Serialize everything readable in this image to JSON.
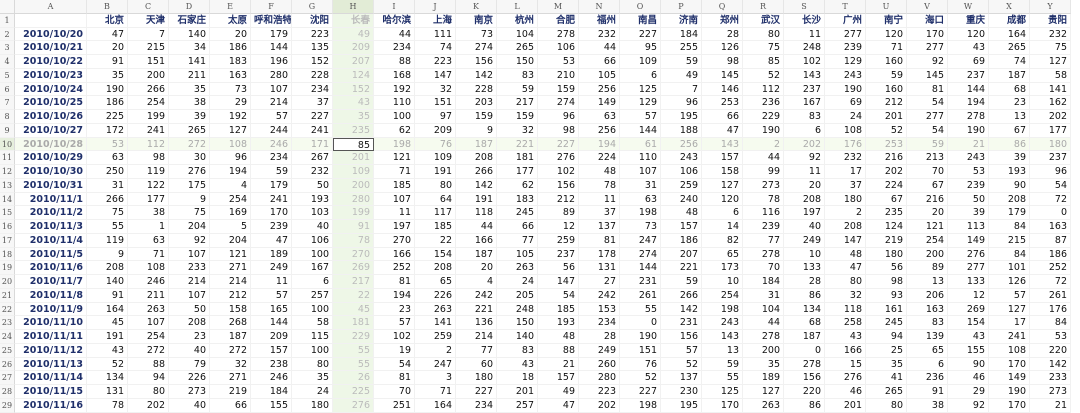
{
  "sheet": {
    "column_letters": [
      "A",
      "B",
      "C",
      "D",
      "E",
      "F",
      "G",
      "H",
      "I",
      "J",
      "K",
      "L",
      "M",
      "N",
      "O",
      "P",
      "Q",
      "R",
      "S",
      "T",
      "U",
      "V",
      "W",
      "X",
      "Y"
    ],
    "cities": [
      "北京",
      "天津",
      "石家庄",
      "太原",
      "呼和浩特",
      "沈阳",
      "长春",
      "哈尔滨",
      "上海",
      "南京",
      "杭州",
      "合肥",
      "福州",
      "南昌",
      "济南",
      "郑州",
      "武汉",
      "长沙",
      "广州",
      "南宁",
      "海口",
      "重庆",
      "成都",
      "贵阳"
    ],
    "selected_column": "H",
    "selected_row": 10,
    "active_cell_value": "85",
    "rows": [
      {
        "num": "2",
        "date": "2010/10/20",
        "values": [
          "47",
          "7",
          "140",
          "20",
          "179",
          "223",
          "49",
          "44",
          "111",
          "73",
          "104",
          "278",
          "232",
          "227",
          "184",
          "28",
          "80",
          "11",
          "277",
          "120",
          "170",
          "120",
          "164",
          "232"
        ]
      },
      {
        "num": "3",
        "date": "2010/10/21",
        "values": [
          "20",
          "215",
          "34",
          "186",
          "144",
          "135",
          "209",
          "234",
          "74",
          "274",
          "265",
          "106",
          "44",
          "95",
          "255",
          "126",
          "75",
          "248",
          "239",
          "71",
          "277",
          "43",
          "265",
          "75"
        ]
      },
      {
        "num": "4",
        "date": "2010/10/22",
        "values": [
          "91",
          "151",
          "141",
          "183",
          "196",
          "152",
          "207",
          "88",
          "223",
          "156",
          "150",
          "53",
          "66",
          "109",
          "59",
          "98",
          "85",
          "102",
          "129",
          "160",
          "92",
          "69",
          "74",
          "127"
        ]
      },
      {
        "num": "5",
        "date": "2010/10/23",
        "values": [
          "35",
          "200",
          "211",
          "163",
          "280",
          "228",
          "124",
          "168",
          "147",
          "142",
          "83",
          "210",
          "105",
          "6",
          "49",
          "145",
          "52",
          "143",
          "243",
          "59",
          "145",
          "237",
          "187",
          "58"
        ]
      },
      {
        "num": "6",
        "date": "2010/10/24",
        "values": [
          "190",
          "266",
          "35",
          "73",
          "107",
          "234",
          "152",
          "192",
          "32",
          "228",
          "59",
          "159",
          "256",
          "125",
          "7",
          "146",
          "112",
          "237",
          "190",
          "160",
          "81",
          "144",
          "68",
          "141"
        ]
      },
      {
        "num": "7",
        "date": "2010/10/25",
        "values": [
          "186",
          "254",
          "38",
          "29",
          "214",
          "37",
          "43",
          "110",
          "151",
          "203",
          "217",
          "274",
          "149",
          "129",
          "96",
          "253",
          "236",
          "167",
          "69",
          "212",
          "54",
          "194",
          "23",
          "162"
        ]
      },
      {
        "num": "8",
        "date": "2010/10/26",
        "values": [
          "225",
          "199",
          "39",
          "192",
          "57",
          "227",
          "35",
          "100",
          "97",
          "159",
          "159",
          "96",
          "63",
          "57",
          "195",
          "66",
          "229",
          "83",
          "24",
          "201",
          "277",
          "278",
          "13",
          "202"
        ]
      },
      {
        "num": "9",
        "date": "2010/10/27",
        "values": [
          "172",
          "241",
          "265",
          "127",
          "244",
          "241",
          "235",
          "62",
          "209",
          "9",
          "32",
          "98",
          "256",
          "144",
          "188",
          "47",
          "190",
          "6",
          "108",
          "52",
          "54",
          "190",
          "67",
          "177"
        ]
      },
      {
        "num": "10",
        "date": "2010/10/28",
        "values": [
          "53",
          "112",
          "272",
          "108",
          "246",
          "171",
          "85",
          "198",
          "76",
          "187",
          "221",
          "227",
          "194",
          "61",
          "256",
          "143",
          "2",
          "202",
          "176",
          "253",
          "59",
          "21",
          "86",
          "180"
        ]
      },
      {
        "num": "11",
        "date": "2010/10/29",
        "values": [
          "63",
          "98",
          "30",
          "96",
          "234",
          "267",
          "201",
          "121",
          "109",
          "208",
          "181",
          "276",
          "224",
          "110",
          "243",
          "157",
          "44",
          "92",
          "232",
          "216",
          "213",
          "243",
          "39",
          "237"
        ]
      },
      {
        "num": "12",
        "date": "2010/10/30",
        "values": [
          "250",
          "119",
          "276",
          "194",
          "59",
          "232",
          "109",
          "71",
          "191",
          "266",
          "177",
          "102",
          "48",
          "107",
          "106",
          "158",
          "99",
          "11",
          "17",
          "202",
          "70",
          "53",
          "193",
          "96"
        ]
      },
      {
        "num": "13",
        "date": "2010/10/31",
        "values": [
          "31",
          "122",
          "175",
          "4",
          "179",
          "50",
          "200",
          "185",
          "80",
          "142",
          "62",
          "156",
          "78",
          "31",
          "259",
          "127",
          "273",
          "20",
          "37",
          "224",
          "67",
          "239",
          "90",
          "54"
        ]
      },
      {
        "num": "14",
        "date": "2010/11/1",
        "values": [
          "266",
          "177",
          "9",
          "254",
          "241",
          "193",
          "280",
          "107",
          "64",
          "191",
          "183",
          "212",
          "11",
          "63",
          "240",
          "120",
          "78",
          "208",
          "180",
          "67",
          "216",
          "50",
          "208",
          "72"
        ]
      },
      {
        "num": "15",
        "date": "2010/11/2",
        "values": [
          "75",
          "38",
          "75",
          "169",
          "170",
          "103",
          "199",
          "11",
          "117",
          "118",
          "245",
          "89",
          "37",
          "198",
          "48",
          "6",
          "116",
          "197",
          "2",
          "235",
          "20",
          "39",
          "179",
          "0"
        ]
      },
      {
        "num": "16",
        "date": "2010/11/3",
        "values": [
          "55",
          "1",
          "204",
          "5",
          "239",
          "40",
          "91",
          "197",
          "185",
          "44",
          "66",
          "12",
          "137",
          "73",
          "157",
          "14",
          "239",
          "40",
          "208",
          "124",
          "121",
          "113",
          "84",
          "163"
        ]
      },
      {
        "num": "17",
        "date": "2010/11/4",
        "values": [
          "119",
          "63",
          "92",
          "204",
          "47",
          "106",
          "78",
          "270",
          "22",
          "166",
          "77",
          "259",
          "81",
          "247",
          "186",
          "82",
          "77",
          "249",
          "147",
          "219",
          "254",
          "149",
          "215",
          "87"
        ]
      },
      {
        "num": "18",
        "date": "2010/11/5",
        "values": [
          "9",
          "71",
          "107",
          "121",
          "189",
          "100",
          "270",
          "166",
          "154",
          "187",
          "105",
          "237",
          "178",
          "274",
          "207",
          "65",
          "278",
          "10",
          "48",
          "180",
          "200",
          "276",
          "84",
          "186"
        ]
      },
      {
        "num": "19",
        "date": "2010/11/6",
        "values": [
          "208",
          "108",
          "233",
          "271",
          "249",
          "167",
          "269",
          "252",
          "208",
          "20",
          "263",
          "56",
          "131",
          "144",
          "221",
          "173",
          "70",
          "133",
          "47",
          "56",
          "89",
          "277",
          "101",
          "252"
        ]
      },
      {
        "num": "20",
        "date": "2010/11/7",
        "values": [
          "140",
          "246",
          "214",
          "214",
          "11",
          "6",
          "217",
          "81",
          "65",
          "4",
          "24",
          "147",
          "27",
          "231",
          "59",
          "10",
          "184",
          "28",
          "80",
          "98",
          "13",
          "133",
          "126",
          "72"
        ]
      },
      {
        "num": "21",
        "date": "2010/11/8",
        "values": [
          "91",
          "211",
          "107",
          "212",
          "57",
          "257",
          "22",
          "194",
          "226",
          "242",
          "205",
          "54",
          "242",
          "261",
          "266",
          "254",
          "31",
          "86",
          "32",
          "93",
          "206",
          "12",
          "57",
          "261"
        ]
      },
      {
        "num": "22",
        "date": "2010/11/9",
        "values": [
          "164",
          "263",
          "50",
          "158",
          "165",
          "100",
          "45",
          "23",
          "263",
          "221",
          "248",
          "185",
          "153",
          "55",
          "142",
          "198",
          "104",
          "134",
          "118",
          "161",
          "163",
          "269",
          "127",
          "176"
        ]
      },
      {
        "num": "23",
        "date": "2010/11/10",
        "values": [
          "45",
          "107",
          "208",
          "268",
          "144",
          "58",
          "181",
          "57",
          "141",
          "136",
          "150",
          "193",
          "234",
          "0",
          "231",
          "243",
          "44",
          "68",
          "258",
          "245",
          "83",
          "154",
          "17",
          "84"
        ]
      },
      {
        "num": "24",
        "date": "2010/11/11",
        "values": [
          "191",
          "254",
          "23",
          "187",
          "209",
          "115",
          "229",
          "102",
          "259",
          "214",
          "140",
          "48",
          "28",
          "190",
          "156",
          "143",
          "278",
          "187",
          "43",
          "94",
          "139",
          "43",
          "241",
          "53"
        ]
      },
      {
        "num": "25",
        "date": "2010/11/12",
        "values": [
          "43",
          "272",
          "40",
          "272",
          "157",
          "100",
          "55",
          "19",
          "2",
          "77",
          "83",
          "88",
          "249",
          "151",
          "57",
          "13",
          "200",
          "0",
          "166",
          "25",
          "65",
          "155",
          "108",
          "220"
        ]
      },
      {
        "num": "26",
        "date": "2010/11/13",
        "values": [
          "52",
          "88",
          "79",
          "32",
          "238",
          "80",
          "55",
          "54",
          "247",
          "60",
          "43",
          "21",
          "260",
          "76",
          "52",
          "59",
          "35",
          "278",
          "15",
          "35",
          "6",
          "90",
          "170",
          "142"
        ]
      },
      {
        "num": "27",
        "date": "2010/11/14",
        "values": [
          "134",
          "94",
          "226",
          "271",
          "246",
          "35",
          "26",
          "81",
          "3",
          "180",
          "18",
          "157",
          "280",
          "52",
          "137",
          "55",
          "189",
          "156",
          "276",
          "41",
          "236",
          "46",
          "149",
          "233"
        ]
      },
      {
        "num": "28",
        "date": "2010/11/15",
        "values": [
          "131",
          "80",
          "273",
          "219",
          "184",
          "24",
          "225",
          "70",
          "71",
          "227",
          "201",
          "49",
          "223",
          "227",
          "230",
          "125",
          "127",
          "220",
          "46",
          "265",
          "91",
          "29",
          "190",
          "273"
        ]
      },
      {
        "num": "29",
        "date": "2010/11/16",
        "values": [
          "78",
          "202",
          "40",
          "66",
          "155",
          "180",
          "276",
          "251",
          "164",
          "234",
          "257",
          "47",
          "202",
          "198",
          "195",
          "170",
          "263",
          "86",
          "201",
          "80",
          "38",
          "92",
          "170",
          "21"
        ]
      }
    ]
  }
}
